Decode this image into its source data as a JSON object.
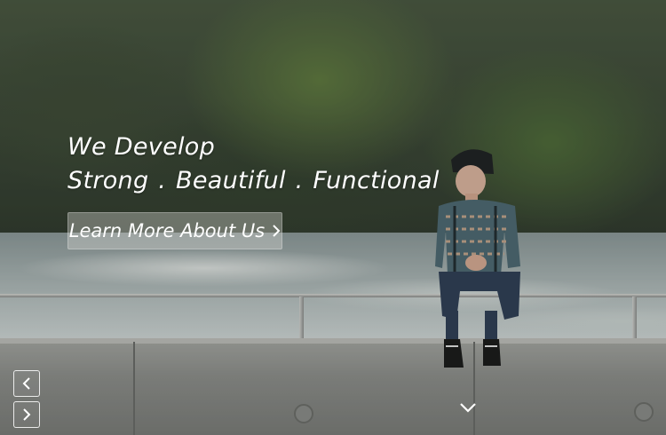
{
  "hero": {
    "headline_line1": "We Develop",
    "headline_line2": "Strong .  Beautiful .  Functional",
    "cta_label": "Learn More About Us",
    "cta_icon": "chevron-right-icon"
  },
  "slider": {
    "prev_icon": "chevron-left-icon",
    "next_icon": "chevron-right-icon",
    "scroll_icon": "chevron-down-icon"
  },
  "colors": {
    "text": "#ffffff",
    "cta_background": "rgba(215,215,210,0.38)",
    "nav_border": "#ffffff"
  }
}
